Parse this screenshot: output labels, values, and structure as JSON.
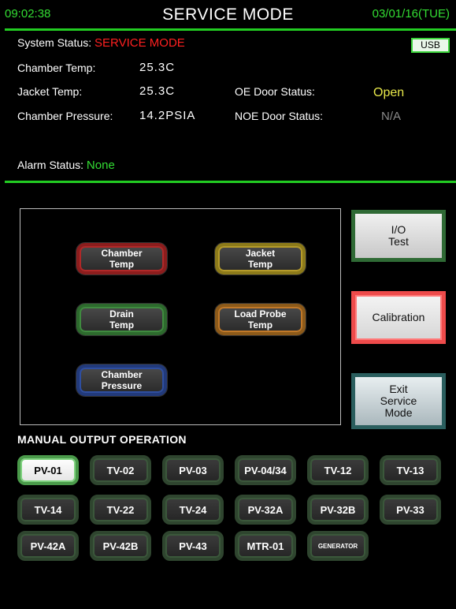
{
  "header": {
    "time": "09:02:38",
    "title": "SERVICE MODE",
    "date": "03/01/16(TUE)"
  },
  "status": {
    "system_status_label": "System Status:",
    "system_status_value": "SERVICE MODE",
    "usb_label": "USB",
    "chamber_temp_label": "Chamber Temp:",
    "chamber_temp_value": "25.3C",
    "jacket_temp_label": "Jacket Temp:",
    "jacket_temp_value": "25.3C",
    "chamber_pressure_label": "Chamber Pressure:",
    "chamber_pressure_value": "14.2PSIA",
    "oe_door_label": "OE Door Status:",
    "oe_door_value": "Open",
    "noe_door_label": "NOE Door Status:",
    "noe_door_value": "N/A",
    "alarm_label": "Alarm Status:",
    "alarm_value": "None"
  },
  "sensors": {
    "chamber_temp": "Chamber\nTemp",
    "jacket_temp": "Jacket\nTemp",
    "drain_temp": "Drain\nTemp",
    "load_probe_temp": "Load Probe\nTemp",
    "chamber_pressure": "Chamber\nPressure"
  },
  "actions": {
    "io_test": "I/O\nTest",
    "calibration": "Calibration",
    "exit_service": "Exit\nService\nMode"
  },
  "manual": {
    "title": "MANUAL OUTPUT OPERATION",
    "buttons": [
      "PV-01",
      "TV-02",
      "PV-03",
      "PV-04/34",
      "TV-12",
      "TV-13",
      "TV-14",
      "TV-22",
      "TV-24",
      "PV-32A",
      "PV-32B",
      "PV-33",
      "PV-42A",
      "PV-42B",
      "PV-43",
      "MTR-01",
      "GENERATOR"
    ]
  },
  "colors": {
    "accent_green": "#22cc22",
    "alert_red": "#ff2020",
    "status_yellow": "#e8e84a"
  }
}
